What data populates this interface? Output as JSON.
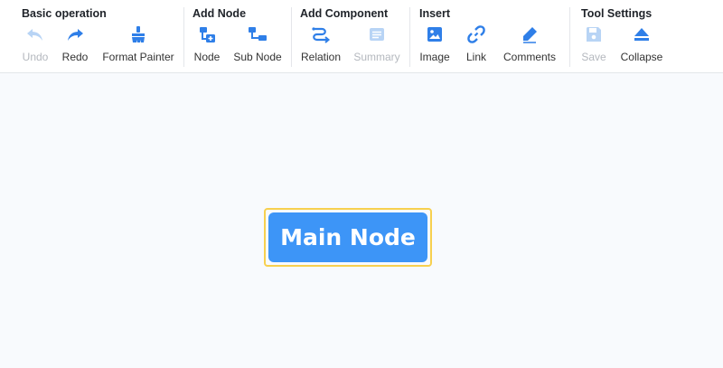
{
  "toolbar": {
    "groups": [
      {
        "title": "Basic operation",
        "tools": [
          {
            "label": "Undo",
            "icon": "undo-icon",
            "disabled": true
          },
          {
            "label": "Redo",
            "icon": "redo-icon",
            "disabled": false
          },
          {
            "label": "Format Painter",
            "icon": "format-painter-icon",
            "disabled": false
          }
        ]
      },
      {
        "title": "Add Node",
        "tools": [
          {
            "label": "Node",
            "icon": "add-node-icon",
            "disabled": false
          },
          {
            "label": "Sub Node",
            "icon": "sub-node-icon",
            "disabled": false
          }
        ]
      },
      {
        "title": "Add Component",
        "tools": [
          {
            "label": "Relation",
            "icon": "relation-icon",
            "disabled": false
          },
          {
            "label": "Summary",
            "icon": "summary-icon",
            "disabled": true
          }
        ]
      },
      {
        "title": "Insert",
        "tools": [
          {
            "label": "Image",
            "icon": "image-icon",
            "disabled": false
          },
          {
            "label": "Link",
            "icon": "link-icon",
            "disabled": false
          },
          {
            "label": "Comments",
            "icon": "comments-icon",
            "disabled": false
          }
        ]
      },
      {
        "title": "Tool Settings",
        "tools": [
          {
            "label": "Save",
            "icon": "save-icon",
            "disabled": true
          },
          {
            "label": "Collapse",
            "icon": "collapse-icon",
            "disabled": false
          }
        ]
      }
    ]
  },
  "canvas": {
    "main_node": {
      "label": "Main Node",
      "selected": true
    }
  },
  "colors": {
    "accent": "#3d95f7",
    "icon_active": "#2f7fe8",
    "icon_disabled": "#b8d4f5",
    "selection": "#f7d04f"
  }
}
